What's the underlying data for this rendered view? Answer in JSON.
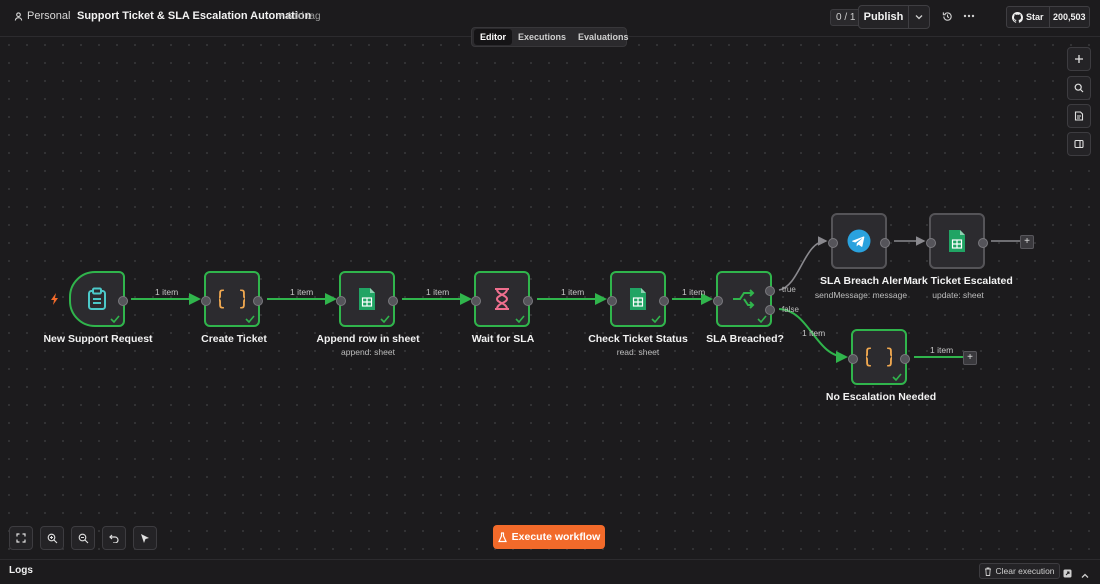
{
  "header": {
    "project": "Personal",
    "workflow_title": "Support Ticket & SLA Escalation Automation",
    "add_tag": "+ Add tag",
    "counter": "0 / 1",
    "publish_label": "Publish",
    "github_star": "Star",
    "github_count": "200,503"
  },
  "tabs": [
    "Editor",
    "Executions",
    "Evaluations"
  ],
  "active_tab": "Editor",
  "nodes": [
    {
      "id": "new-support-request",
      "label": "New Support Request",
      "sub": "",
      "icon": "clipboard-icon",
      "status": "success"
    },
    {
      "id": "create-ticket",
      "label": "Create Ticket",
      "sub": "",
      "icon": "code-braces-icon",
      "status": "success"
    },
    {
      "id": "append-row",
      "label": "Append row in sheet",
      "sub": "append: sheet",
      "icon": "google-sheets-icon",
      "status": "success"
    },
    {
      "id": "wait-for-sla",
      "label": "Wait for SLA",
      "sub": "",
      "icon": "hourglass-icon",
      "status": "success"
    },
    {
      "id": "check-ticket-status",
      "label": "Check Ticket Status",
      "sub": "read: sheet",
      "icon": "google-sheets-icon",
      "status": "success"
    },
    {
      "id": "sla-breached",
      "label": "SLA Breached?",
      "sub": "",
      "icon": "if-branch-icon",
      "status": "success"
    },
    {
      "id": "sla-breach-alert",
      "label": "SLA Breach Aler",
      "sub": "sendMessage: message",
      "icon": "telegram-icon",
      "status": "idle"
    },
    {
      "id": "mark-ticket-escalated",
      "label": "Mark Ticket Escalated",
      "sub": "update: sheet",
      "icon": "google-sheets-icon",
      "status": "idle"
    },
    {
      "id": "no-escalation-needed",
      "label": "No Escalation Needed",
      "sub": "",
      "icon": "code-braces-icon",
      "status": "success"
    }
  ],
  "edge_labels": [
    "1 item",
    "1 item",
    "1 item",
    "1 item",
    "1 item",
    "1 item",
    "1 item"
  ],
  "branch_labels": {
    "true": "true",
    "false": "false"
  },
  "execute_label": "Execute workflow",
  "logs": {
    "title": "Logs",
    "clear_label": "Clear execution"
  },
  "colors": {
    "success": "#30b54c",
    "accent": "#f26a2a",
    "idle": "#555458"
  }
}
